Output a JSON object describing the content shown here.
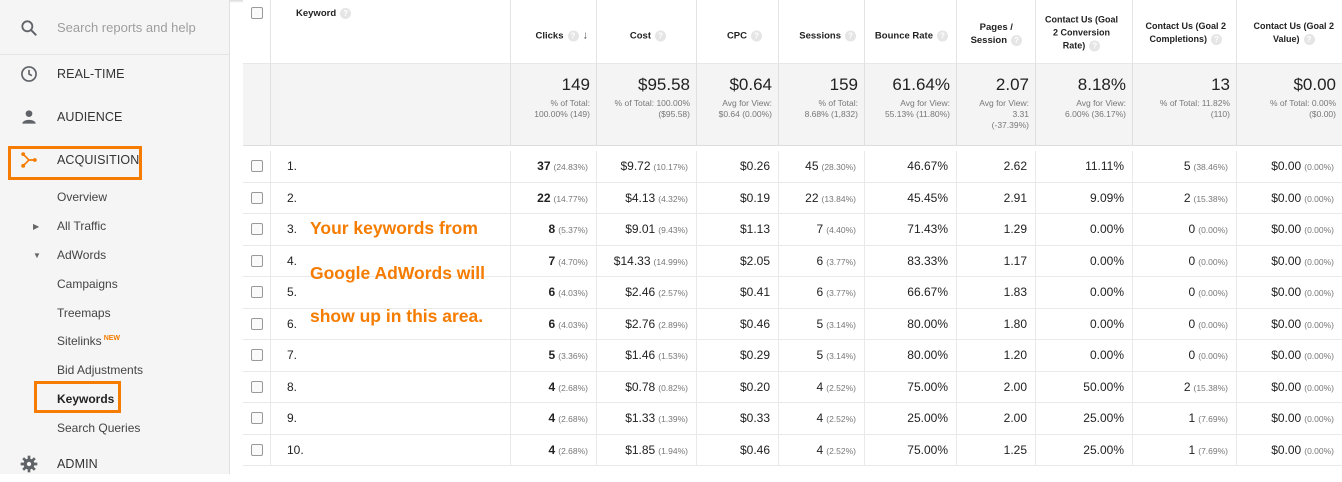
{
  "sidebar": {
    "search_placeholder": "Search reports and help",
    "realtime": "REAL-TIME",
    "audience": "AUDIENCE",
    "acquisition": "ACQUISITION",
    "overview": "Overview",
    "all_traffic": "All Traffic",
    "adwords": "AdWords",
    "campaigns": "Campaigns",
    "treemaps": "Treemaps",
    "sitelinks": "Sitelinks",
    "sitelinks_badge": "NEW",
    "bid_adjustments": "Bid Adjustments",
    "keywords": "Keywords",
    "search_queries": "Search Queries",
    "admin": "ADMIN",
    "highlight_color": "#f57c00"
  },
  "table": {
    "headers": {
      "keyword": "Keyword",
      "clicks": "Clicks",
      "cost": "Cost",
      "cpc": "CPC",
      "sessions": "Sessions",
      "bounce": "Bounce Rate",
      "pages_l1": "Pages /",
      "pages_l2": "Session",
      "conv_l1": "Contact Us (Goal",
      "conv_l2": "2 Conversion",
      "conv_l3": "Rate)",
      "comp_l1": "Contact Us (Goal 2",
      "comp_l2": "Completions)",
      "val_l1": "Contact Us (Goal 2",
      "val_l2": "Value)"
    },
    "totals": {
      "clicks": {
        "big": "149",
        "l1": "% of Total:",
        "l2": "100.00% (149)"
      },
      "cost": {
        "big": "$95.58",
        "l1": "% of Total: 100.00%",
        "l2": "($95.58)"
      },
      "cpc": {
        "big": "$0.64",
        "l1": "Avg for View:",
        "l2": "$0.64 (0.00%)"
      },
      "sessions": {
        "big": "159",
        "l1": "% of Total:",
        "l2": "8.68% (1,832)"
      },
      "bounce": {
        "big": "61.64%",
        "l1": "Avg for View:",
        "l2": "55.13% (11.80%)"
      },
      "pages": {
        "big": "2.07",
        "l1": "Avg for View:",
        "l2": "3.31",
        "l3": "(-37.39%)"
      },
      "conv": {
        "big": "8.18%",
        "l1": "Avg for View:",
        "l2": "6.00% (36.17%)"
      },
      "comp": {
        "big": "13",
        "l1": "% of Total: 11.82%",
        "l2": "(110)"
      },
      "val": {
        "big": "$0.00",
        "l1": "% of Total: 0.00%",
        "l2": "($0.00)"
      }
    },
    "rows": [
      {
        "n": "1.",
        "clicks": "37",
        "clicks_pct": "(24.83%)",
        "cost": "$9.72",
        "cost_pct": "(10.17%)",
        "cpc": "$0.26",
        "sessions": "45",
        "sessions_pct": "(28.30%)",
        "bounce": "46.67%",
        "pages": "2.62",
        "conv": "11.11%",
        "comp": "5",
        "comp_pct": "(38.46%)",
        "val": "$0.00",
        "val_pct": "(0.00%)"
      },
      {
        "n": "2.",
        "clicks": "22",
        "clicks_pct": "(14.77%)",
        "cost": "$4.13",
        "cost_pct": "(4.32%)",
        "cpc": "$0.19",
        "sessions": "22",
        "sessions_pct": "(13.84%)",
        "bounce": "45.45%",
        "pages": "2.91",
        "conv": "9.09%",
        "comp": "2",
        "comp_pct": "(15.38%)",
        "val": "$0.00",
        "val_pct": "(0.00%)"
      },
      {
        "n": "3.",
        "clicks": "8",
        "clicks_pct": "(5.37%)",
        "cost": "$9.01",
        "cost_pct": "(9.43%)",
        "cpc": "$1.13",
        "sessions": "7",
        "sessions_pct": "(4.40%)",
        "bounce": "71.43%",
        "pages": "1.29",
        "conv": "0.00%",
        "comp": "0",
        "comp_pct": "(0.00%)",
        "val": "$0.00",
        "val_pct": "(0.00%)"
      },
      {
        "n": "4.",
        "clicks": "7",
        "clicks_pct": "(4.70%)",
        "cost": "$14.33",
        "cost_pct": "(14.99%)",
        "cpc": "$2.05",
        "sessions": "6",
        "sessions_pct": "(3.77%)",
        "bounce": "83.33%",
        "pages": "1.17",
        "conv": "0.00%",
        "comp": "0",
        "comp_pct": "(0.00%)",
        "val": "$0.00",
        "val_pct": "(0.00%)"
      },
      {
        "n": "5.",
        "clicks": "6",
        "clicks_pct": "(4.03%)",
        "cost": "$2.46",
        "cost_pct": "(2.57%)",
        "cpc": "$0.41",
        "sessions": "6",
        "sessions_pct": "(3.77%)",
        "bounce": "66.67%",
        "pages": "1.83",
        "conv": "0.00%",
        "comp": "0",
        "comp_pct": "(0.00%)",
        "val": "$0.00",
        "val_pct": "(0.00%)"
      },
      {
        "n": "6.",
        "clicks": "6",
        "clicks_pct": "(4.03%)",
        "cost": "$2.76",
        "cost_pct": "(2.89%)",
        "cpc": "$0.46",
        "sessions": "5",
        "sessions_pct": "(3.14%)",
        "bounce": "80.00%",
        "pages": "1.80",
        "conv": "0.00%",
        "comp": "0",
        "comp_pct": "(0.00%)",
        "val": "$0.00",
        "val_pct": "(0.00%)"
      },
      {
        "n": "7.",
        "clicks": "5",
        "clicks_pct": "(3.36%)",
        "cost": "$1.46",
        "cost_pct": "(1.53%)",
        "cpc": "$0.29",
        "sessions": "5",
        "sessions_pct": "(3.14%)",
        "bounce": "80.00%",
        "pages": "1.20",
        "conv": "0.00%",
        "comp": "0",
        "comp_pct": "(0.00%)",
        "val": "$0.00",
        "val_pct": "(0.00%)"
      },
      {
        "n": "8.",
        "clicks": "4",
        "clicks_pct": "(2.68%)",
        "cost": "$0.78",
        "cost_pct": "(0.82%)",
        "cpc": "$0.20",
        "sessions": "4",
        "sessions_pct": "(2.52%)",
        "bounce": "75.00%",
        "pages": "2.00",
        "conv": "50.00%",
        "comp": "2",
        "comp_pct": "(15.38%)",
        "val": "$0.00",
        "val_pct": "(0.00%)"
      },
      {
        "n": "9.",
        "clicks": "4",
        "clicks_pct": "(2.68%)",
        "cost": "$1.33",
        "cost_pct": "(1.39%)",
        "cpc": "$0.33",
        "sessions": "4",
        "sessions_pct": "(2.52%)",
        "bounce": "25.00%",
        "pages": "2.00",
        "conv": "25.00%",
        "comp": "1",
        "comp_pct": "(7.69%)",
        "val": "$0.00",
        "val_pct": "(0.00%)"
      },
      {
        "n": "10.",
        "clicks": "4",
        "clicks_pct": "(2.68%)",
        "cost": "$1.85",
        "cost_pct": "(1.94%)",
        "cpc": "$0.46",
        "sessions": "4",
        "sessions_pct": "(2.52%)",
        "bounce": "75.00%",
        "pages": "1.25",
        "conv": "25.00%",
        "comp": "1",
        "comp_pct": "(7.69%)",
        "val": "$0.00",
        "val_pct": "(0.00%)"
      }
    ]
  },
  "overlay": {
    "line1": "Your keywords from",
    "line2": "Google AdWords will",
    "line3": "show up in this area.",
    "color": "#f57c00"
  }
}
